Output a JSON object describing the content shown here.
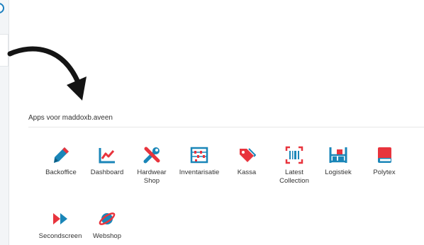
{
  "section": {
    "title": "Apps voor maddoxb.aveen"
  },
  "apps": [
    {
      "label": "Backoffice",
      "icon": "pencil-icon"
    },
    {
      "label": "Dashboard",
      "icon": "line-chart-icon"
    },
    {
      "label": "Hardwear\nShop",
      "icon": "tools-icon"
    },
    {
      "label": "Inventarisatie",
      "icon": "abacus-icon"
    },
    {
      "label": "Kassa",
      "icon": "price-tag-icon"
    },
    {
      "label": "Latest\nCollection",
      "icon": "barcode-scan-icon"
    },
    {
      "label": "Logistiek",
      "icon": "warehouse-rack-icon"
    },
    {
      "label": "Polytex",
      "icon": "book-icon"
    },
    {
      "label": "Secondscreen",
      "icon": "fast-forward-icon"
    },
    {
      "label": "Webshop",
      "icon": "planet-icon"
    }
  ],
  "colors": {
    "teal": "#1a86b8",
    "red": "#e8343d",
    "accent_blue": "#1c7fbf"
  }
}
